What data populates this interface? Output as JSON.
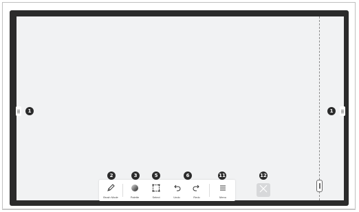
{
  "toolbar": {
    "tools": [
      {
        "id": "brush-mode",
        "label": "Brush Mode",
        "icon": "brush-icon",
        "badge": "2"
      },
      {
        "id": "palette",
        "label": "Palette",
        "icon": "palette-icon",
        "badge": "3"
      },
      {
        "id": "select",
        "label": "Select",
        "icon": "select-icon",
        "badge": "5"
      },
      {
        "id": "undo",
        "label": "Undo",
        "icon": "undo-icon",
        "badge": "6"
      },
      {
        "id": "redo",
        "label": "Redo",
        "icon": "redo-icon",
        "badge": ""
      },
      {
        "id": "menu",
        "label": "Menu",
        "icon": "menu-icon",
        "badge": "11"
      }
    ]
  },
  "callouts": {
    "left_handle": "1",
    "right_handle": "1",
    "brush": "2",
    "palette": "3",
    "select": "5",
    "undo_redo": "6",
    "menu": "11",
    "close": "12"
  },
  "colors": {
    "bezel": "#2b2b2b",
    "canvas": "#f1f2f3",
    "badge": "#2b2b2b",
    "close_button": "#d7d8da"
  }
}
